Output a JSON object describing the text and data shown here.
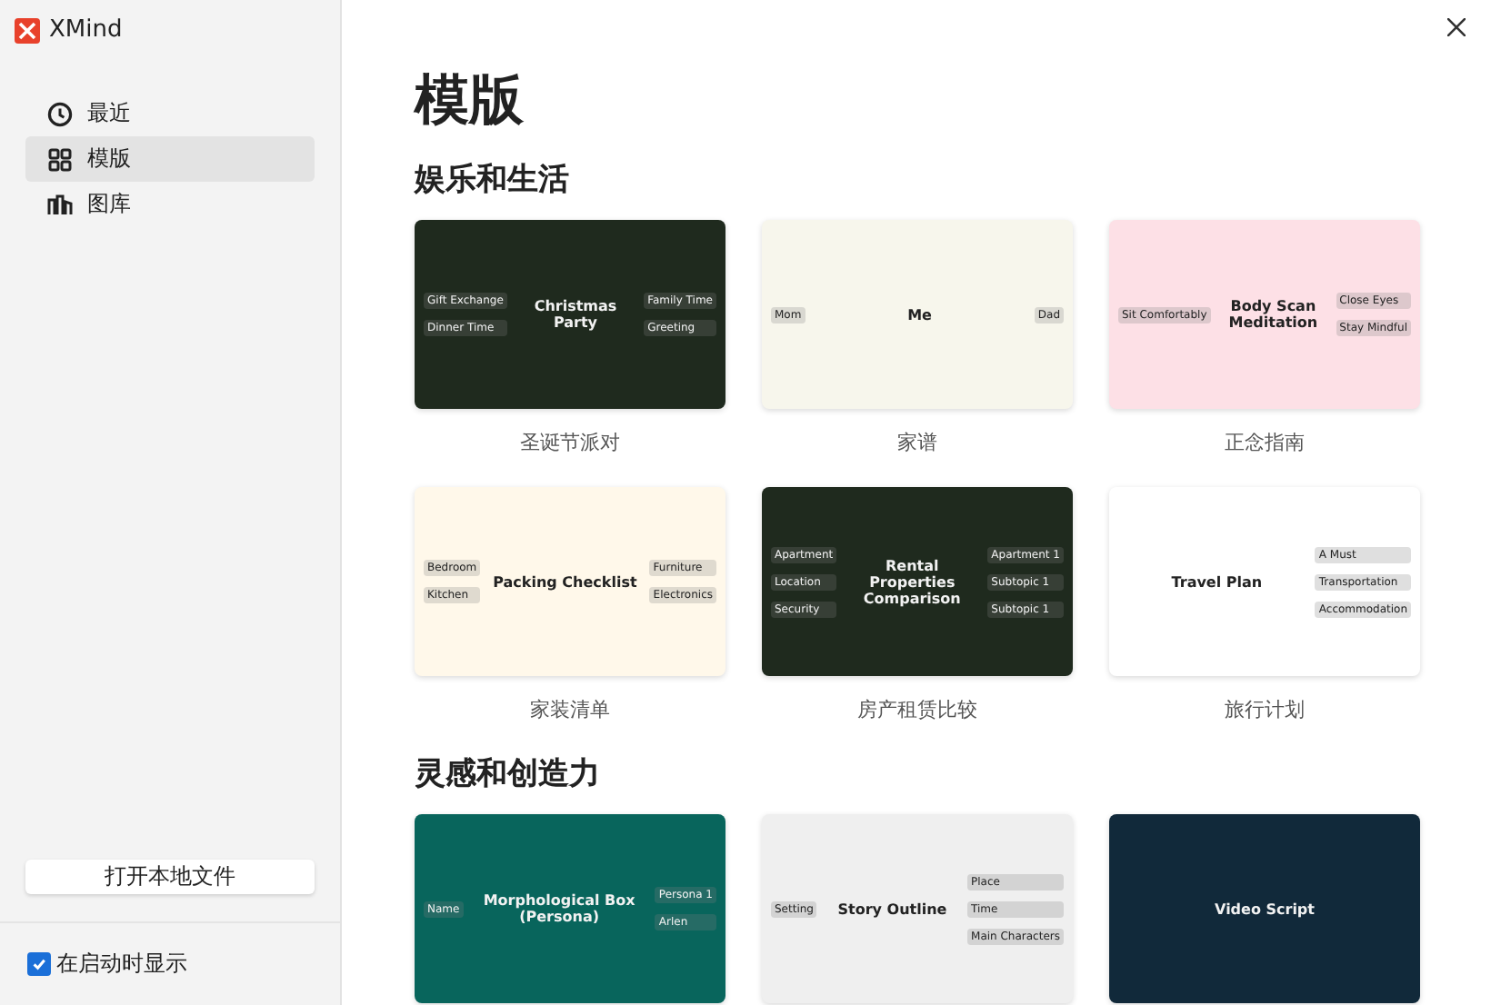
{
  "app": {
    "name": "XMind"
  },
  "nav": [
    {
      "label": "最近",
      "selected": false
    },
    {
      "label": "模版",
      "selected": true
    },
    {
      "label": "图库",
      "selected": false
    }
  ],
  "open_button": "打开本地文件",
  "show_on_startup": {
    "label": "在启动时显示",
    "checked": true
  },
  "page_title": "模版",
  "sections": [
    {
      "heading": "娱乐和生活",
      "templates": [
        {
          "name": "圣诞节派对",
          "preview": {
            "color": "#1f2a1e",
            "title": "Christmas Party",
            "left": [
              "Gift Exchange",
              "Dinner Time"
            ],
            "right": [
              "Family Time",
              "Greeting"
            ]
          }
        },
        {
          "name": "家谱",
          "preview": {
            "color": "#f7f6ec",
            "title": "Me",
            "left": [
              "Mom"
            ],
            "right": [
              "Dad"
            ]
          }
        },
        {
          "name": "正念指南",
          "preview": {
            "color": "#fde0e6",
            "title": "Body Scan Meditation",
            "left": [
              "Sit Comfortably"
            ],
            "right": [
              "Close Eyes",
              "Stay Mindful"
            ]
          }
        }
      ]
    },
    {
      "templates": [
        {
          "name": "家装清单",
          "preview": {
            "color": "#fff8ea",
            "title": "Packing Checklist",
            "left": [
              "Bedroom",
              "Kitchen"
            ],
            "right": [
              "Furniture",
              "Electronics"
            ]
          }
        },
        {
          "name": "房产租赁比较",
          "preview": {
            "color": "#1f2a1e",
            "title": "Rental Properties Comparison",
            "left": [
              "Apartment",
              "Location",
              "Security"
            ],
            "right": [
              "Apartment 1",
              "Subtopic 1",
              "Subtopic 1"
            ]
          }
        },
        {
          "name": "旅行计划",
          "preview": {
            "color": "#ffffff",
            "title": "Travel Plan",
            "right": [
              "A Must",
              "Transportation",
              "Accommodation"
            ]
          }
        }
      ]
    },
    {
      "heading": "灵感和创造力",
      "templates": [
        {
          "preview": {
            "color": "#08655c",
            "title": "Morphological Box (Persona)",
            "left": [
              "Name"
            ],
            "right": [
              "Persona 1",
              "Arlen"
            ]
          }
        },
        {
          "preview": {
            "color": "#efefef",
            "title": "Story Outline",
            "left": [
              "Setting"
            ],
            "right": [
              "Place",
              "Time",
              "Main Characters"
            ]
          }
        },
        {
          "preview": {
            "color": "#11293a",
            "title": "Video Script"
          }
        }
      ]
    }
  ]
}
